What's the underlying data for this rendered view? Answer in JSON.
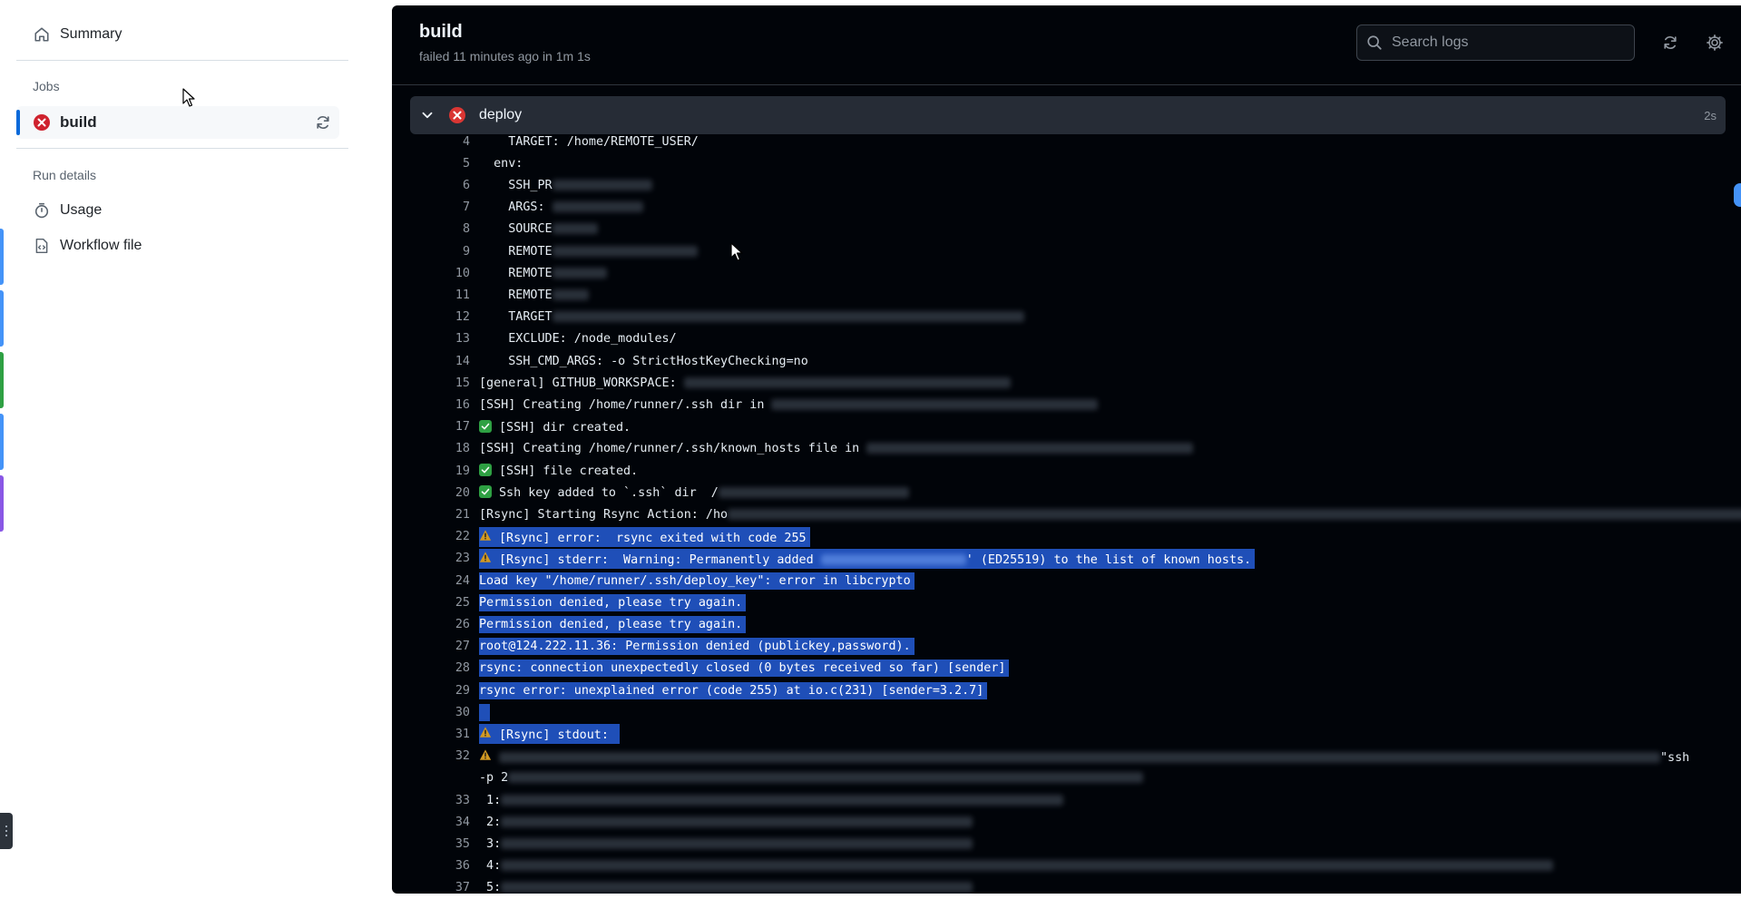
{
  "sidebar": {
    "summary_label": "Summary",
    "jobs_heading": "Jobs",
    "job_label": "build",
    "run_details_heading": "Run details",
    "usage_label": "Usage",
    "workflow_label": "Workflow file",
    "edge_tab_colors": [
      "#4493f8",
      "#4493f8",
      "#2ea043",
      "#4493f8",
      "#8957e5"
    ]
  },
  "panel": {
    "title": "build",
    "status": "failed 11 minutes ago in 1m 1s",
    "search_placeholder": "Search logs",
    "step_name": "deploy",
    "step_duration": "2s"
  },
  "log": {
    "lines": [
      {
        "n": "4",
        "text": "    TARGET: /home/REMOTE_USER/"
      },
      {
        "n": "5",
        "text": "  env:"
      },
      {
        "n": "6",
        "text": "    SSH_PR"
      },
      {
        "n": "7",
        "text": "    ARGS: "
      },
      {
        "n": "8",
        "text": "    SOURCE"
      },
      {
        "n": "9",
        "text": "    REMOTE"
      },
      {
        "n": "10",
        "text": "    REMOTE"
      },
      {
        "n": "11",
        "text": "    REMOTE"
      },
      {
        "n": "12",
        "text": "    TARGET"
      },
      {
        "n": "13",
        "text": "    EXCLUDE: /node_modules/"
      },
      {
        "n": "14",
        "text": "    SSH_CMD_ARGS: -o StrictHostKeyChecking=no"
      },
      {
        "n": "15",
        "text": "[general] GITHUB_WORKSPACE: "
      },
      {
        "n": "16",
        "text": "[SSH] Creating /home/runner/.ssh dir in "
      },
      {
        "n": "17",
        "text": "[SSH] dir created."
      },
      {
        "n": "18",
        "text": "[SSH] Creating /home/runner/.ssh/known_hosts file in "
      },
      {
        "n": "19",
        "text": "[SSH] file created."
      },
      {
        "n": "20",
        "text": "Ssh key added to `.ssh` dir  /"
      },
      {
        "n": "21",
        "text": "[Rsync] Starting Rsync Action: /ho"
      },
      {
        "n": "22",
        "text": "[Rsync] error:  rsync exited with code 255"
      },
      {
        "n": "23",
        "text": "[Rsync] stderr:  Warning: Permanently added ",
        "tail": "' (ED25519) to the list of known hosts."
      },
      {
        "n": "24",
        "text": "Load key \"/home/runner/.ssh/deploy_key\": error in libcrypto"
      },
      {
        "n": "25",
        "text": "Permission denied, please try again."
      },
      {
        "n": "26",
        "text": "Permission denied, please try again."
      },
      {
        "n": "27",
        "text": "root@124.222.11.36: Permission denied (publickey,password)."
      },
      {
        "n": "28",
        "text": "rsync: connection unexpectedly closed (0 bytes received so far) [sender]"
      },
      {
        "n": "29",
        "text": "rsync error: unexplained error (code 255) at io.c(231) [sender=3.2.7]"
      },
      {
        "n": "30",
        "text": ""
      },
      {
        "n": "31",
        "text": "[Rsync] stdout: "
      },
      {
        "n": "32",
        "text": "",
        "tail": "\"ssh"
      },
      {
        "n": "",
        "text": "-p 2"
      },
      {
        "n": "33",
        "text": " 1:"
      },
      {
        "n": "34",
        "text": " 2:"
      },
      {
        "n": "35",
        "text": " 3:"
      },
      {
        "n": "36",
        "text": " 4:"
      },
      {
        "n": "37",
        "text": " 5:"
      }
    ]
  }
}
